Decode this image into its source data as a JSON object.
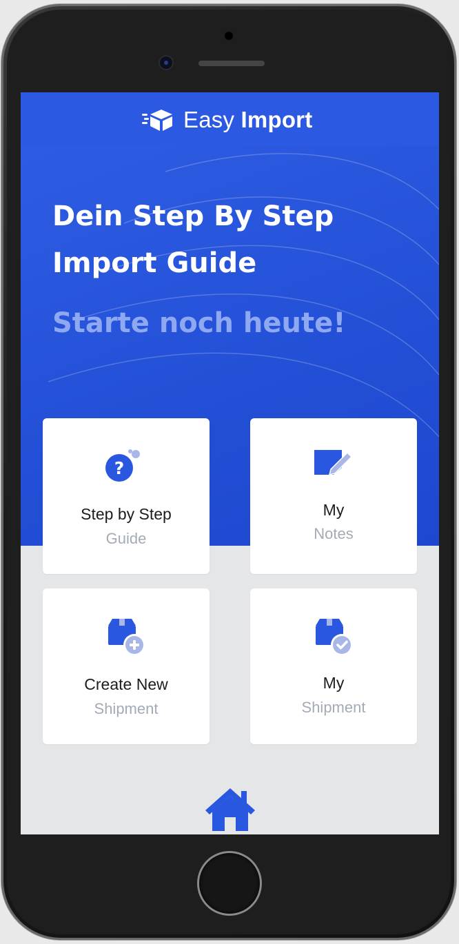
{
  "app": {
    "logo_word1": "Easy",
    "logo_word2": "Import"
  },
  "hero": {
    "title_line1": "Dein Step By Step",
    "title_line2": "Import Guide",
    "subtitle": "Starte noch heute!"
  },
  "cards": [
    {
      "line1": "Step by Step",
      "line2": "Guide",
      "icon": "question-bubble-icon"
    },
    {
      "line1": "My",
      "line2": "Notes",
      "icon": "note-pencil-icon"
    },
    {
      "line1": "Create New",
      "line2": "Shipment",
      "icon": "box-plus-icon"
    },
    {
      "line1": "My",
      "line2": "Shipment",
      "icon": "box-check-icon"
    }
  ],
  "nav": {
    "home_icon": "home-icon"
  },
  "colors": {
    "brand_blue": "#2a57e0",
    "subtitle_blue": "#8ea8f2",
    "background_gray": "#e5e6e8",
    "muted_text": "#a3abb6"
  }
}
